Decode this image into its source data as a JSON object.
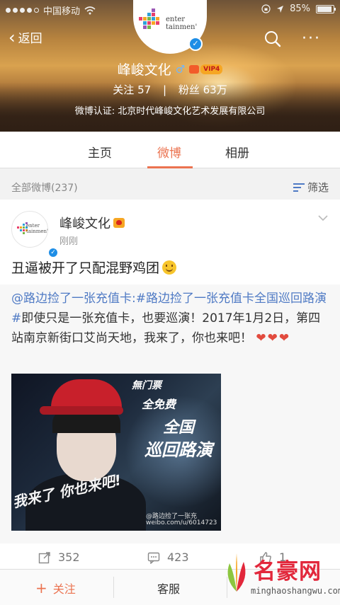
{
  "status_bar": {
    "carrier": "中国移动",
    "time": "",
    "battery": "85%"
  },
  "nav": {
    "back_label": "返回"
  },
  "profile": {
    "logo_text_line1": "enter",
    "logo_text_line2": "tainmen'",
    "name": "峰峻文化",
    "vip_label": "VIP4",
    "following_label": "关注",
    "following_count": "57",
    "followers_label": "粉丝",
    "followers_count": "63万",
    "certification": "微博认证: 北京时代峰峻文化艺术发展有限公司"
  },
  "tabs": [
    {
      "label": "主页"
    },
    {
      "label": "微博"
    },
    {
      "label": "相册"
    }
  ],
  "filter": {
    "count_label": "全部微博(237)",
    "filter_label": "筛选"
  },
  "post": {
    "author": "峰峻文化",
    "time": "刚刚",
    "text": "丑逼被开了只配混野鸡团",
    "repost": {
      "mention": "@路边捡了一张充值卡",
      "topic": ":#路边捡了一张充值卡全国巡回路演#",
      "body": "即使只是一张充值卡，也要巡演！2017年1月2日，第四站南京新街口艾尚天地，我来了，你也来吧！",
      "hearts": "❤❤❤",
      "image_captions": [
        "無门票",
        "全免费",
        "全国",
        "巡回路演",
        "我来了 你也来吧!"
      ],
      "image_handle": "@路边捡了一张充",
      "image_url_text": "weibo.com/u/6014723"
    },
    "reposts": "352",
    "comments": "423",
    "likes": "1"
  },
  "bottom_bar": {
    "follow_label": "关注",
    "service_label": "客服"
  },
  "watermark": {
    "title": "名豪网",
    "url": "minghaoshangwu.com"
  },
  "colors": {
    "accent": "#eb7350",
    "link": "#4f7ac4",
    "verified": "#1e8ee6"
  }
}
